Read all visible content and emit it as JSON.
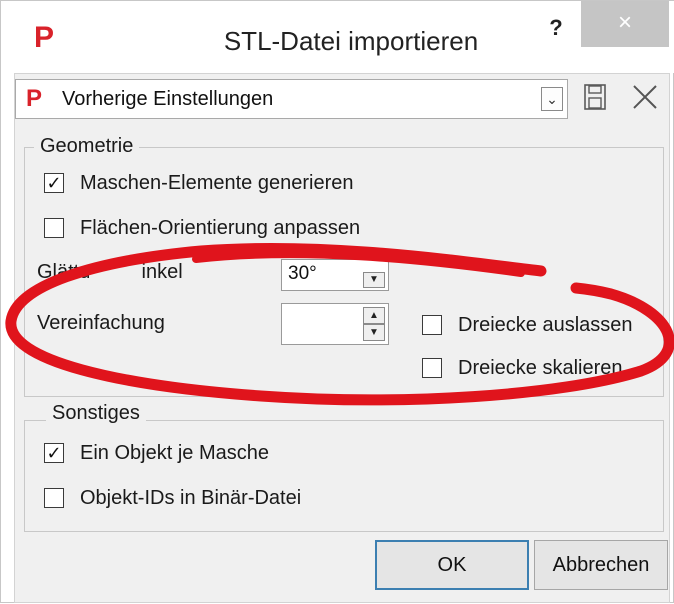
{
  "window": {
    "title": "STL-Datei importieren",
    "logo_glyph": "P",
    "help_label": "?",
    "close_label": "×"
  },
  "preset": {
    "logo_glyph": "P",
    "value": "Vorherige Einstellungen",
    "arrow": "⌄",
    "save_icon": "save-icon",
    "delete_icon": "close-icon"
  },
  "geometrie": {
    "title": "Geometrie",
    "mesh_elements": {
      "label": "Maschen-Elemente generieren",
      "checked": true,
      "check_glyph": "✓"
    },
    "face_orientation": {
      "label": "Flächen-Orientierung anpassen",
      "checked": false
    },
    "smoothing": {
      "label": "Glättungswinkel",
      "visible_fragment_left": "Glättu",
      "visible_fragment_right": "inkel",
      "value": "30°"
    },
    "simplification": {
      "label": "Vereinfachung",
      "value": ""
    },
    "omit_triangles": {
      "label": "Dreiecke auslassen",
      "checked": false
    },
    "scale_triangles": {
      "label": "Dreiecke skalieren",
      "checked": false
    }
  },
  "sonstiges": {
    "title": "Sonstiges",
    "one_object_per_mesh": {
      "label": "Ein Objekt je Masche",
      "checked": true,
      "check_glyph": "✓"
    },
    "object_ids_binary": {
      "label": "Objekt-IDs in Binär-Datei",
      "checked": false
    }
  },
  "buttons": {
    "ok": "OK",
    "cancel": "Abbrechen"
  },
  "colors": {
    "logo_red": "#d9222a",
    "annotation_red": "#e0141c",
    "focus_blue": "#3c7fb1"
  }
}
